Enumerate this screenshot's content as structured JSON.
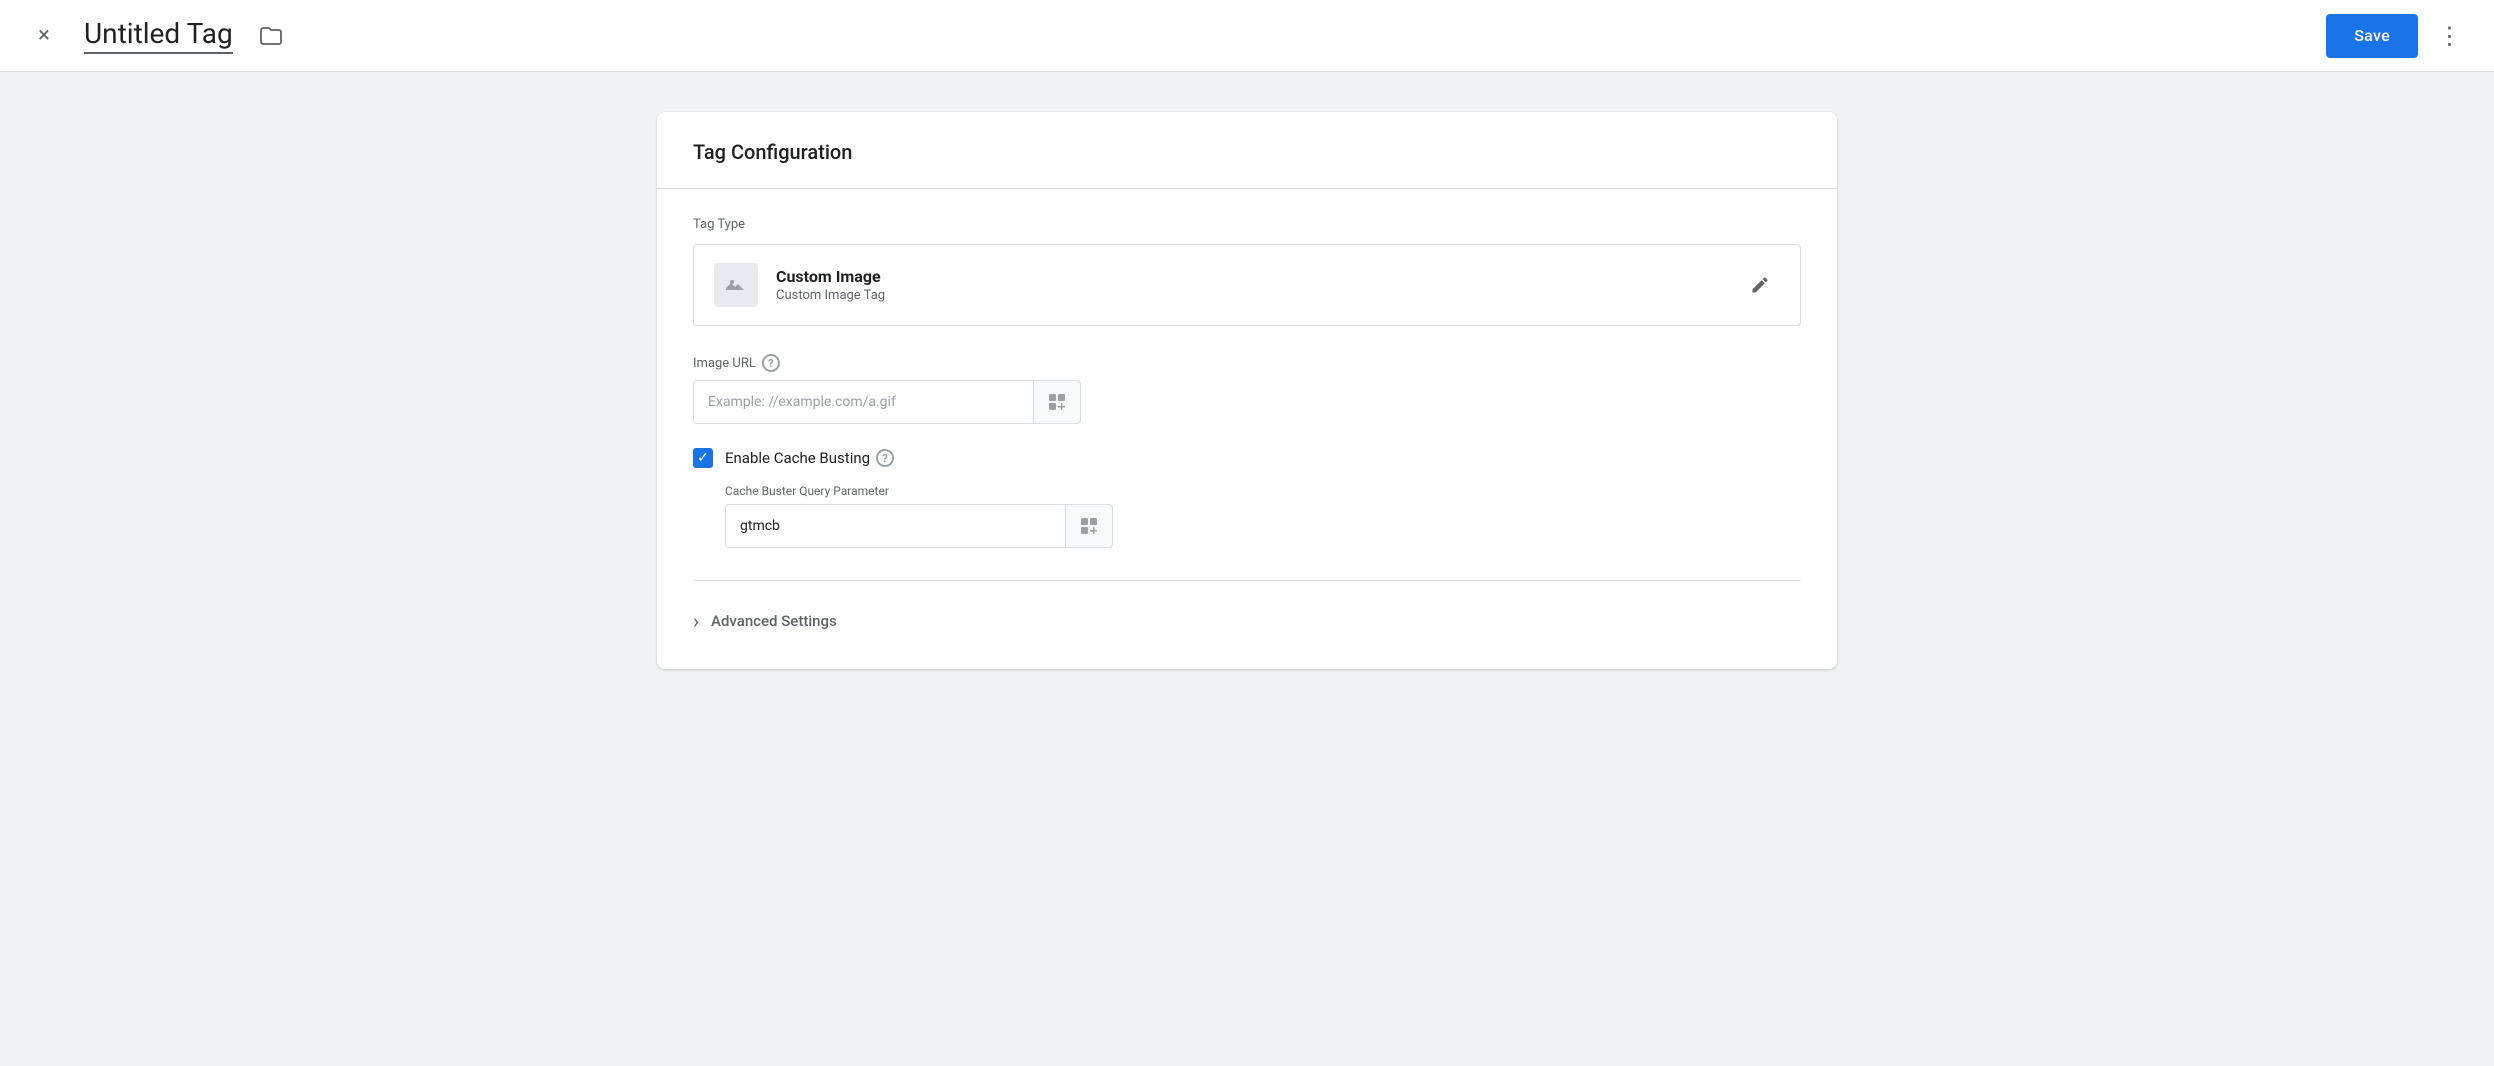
{
  "header": {
    "title": "Untitled Tag",
    "save_label": "Save",
    "close_icon": "×",
    "folder_icon": "⬜",
    "more_icon": "⋮"
  },
  "card": {
    "section_title": "Tag Configuration",
    "tag_type_label": "Tag Type",
    "tag_type_name": "Custom Image",
    "tag_type_subtitle": "Custom Image Tag",
    "image_url_label": "Image URL",
    "image_url_placeholder": "Example: //example.com/a.gif",
    "cache_busting_label": "Enable Cache Busting",
    "cache_buster_param_label": "Cache Buster Query Parameter",
    "cache_buster_value": "gtmcb",
    "advanced_settings_label": "Advanced Settings",
    "help_icon_label": "?"
  },
  "colors": {
    "accent": "#1a73e8",
    "text_primary": "#202124",
    "text_secondary": "#5f6368",
    "border": "#dadce0",
    "bg_light": "#f1f3f4"
  }
}
